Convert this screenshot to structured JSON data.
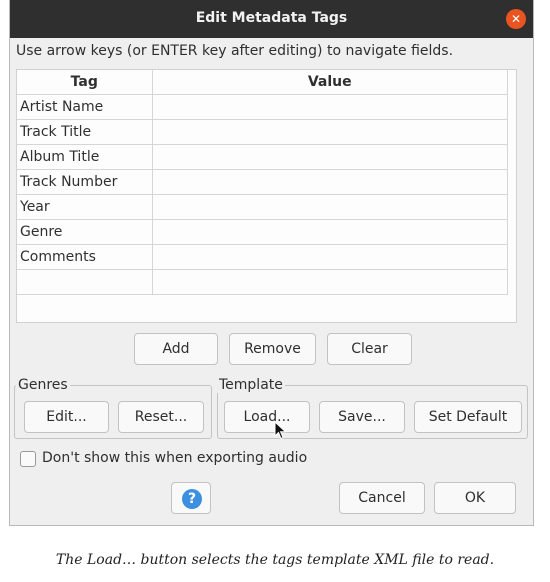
{
  "dialog": {
    "title": "Edit Metadata Tags",
    "close_icon": "✕",
    "instruction": "Use arrow keys (or ENTER key after editing) to navigate fields."
  },
  "table": {
    "headers": [
      "Tag",
      "Value"
    ],
    "rows": [
      {
        "tag": "Artist Name",
        "value": ""
      },
      {
        "tag": "Track Title",
        "value": ""
      },
      {
        "tag": "Album Title",
        "value": ""
      },
      {
        "tag": "Track Number",
        "value": ""
      },
      {
        "tag": "Year",
        "value": ""
      },
      {
        "tag": "Genre",
        "value": ""
      },
      {
        "tag": "Comments",
        "value": ""
      },
      {
        "tag": "",
        "value": ""
      }
    ]
  },
  "row_buttons": {
    "add": "Add",
    "remove": "Remove",
    "clear": "Clear"
  },
  "genres": {
    "label": "Genres",
    "edit": "Edit...",
    "reset": "Reset..."
  },
  "template": {
    "label": "Template",
    "load": "Load...",
    "save": "Save...",
    "set_default": "Set Default"
  },
  "options": {
    "dont_show_label": "Don't show this when exporting audio",
    "dont_show_checked": false
  },
  "footer": {
    "help_icon": "?",
    "cancel": "Cancel",
    "ok": "OK"
  },
  "caption": "The Load… button selects the tags template XML file to read.",
  "colors": {
    "titlebar": "#2f2f2f",
    "close_accent": "#e95420",
    "help_accent": "#3d8fe0",
    "dialog_bg": "#efefef"
  }
}
